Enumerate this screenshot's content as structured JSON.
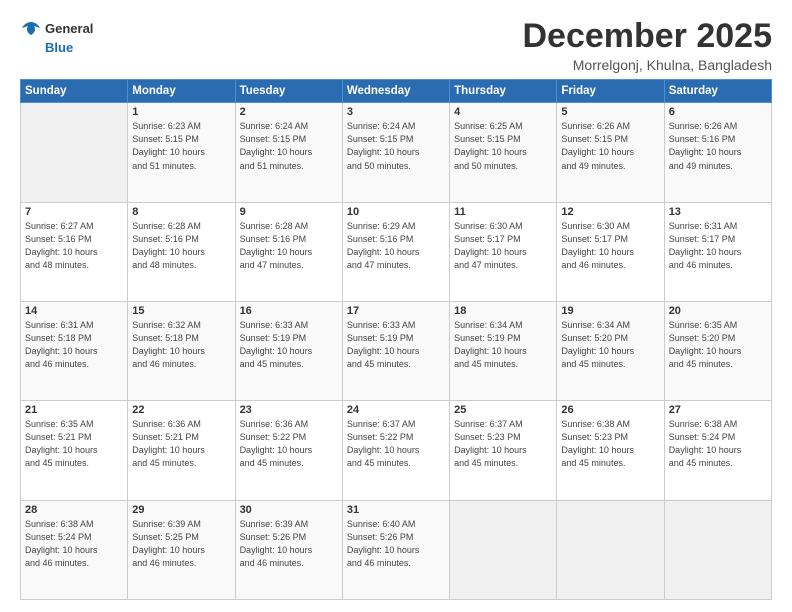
{
  "header": {
    "logo_line1": "General",
    "logo_line2": "Blue",
    "month_title": "December 2025",
    "subtitle": "Morrelgonj, Khulna, Bangladesh"
  },
  "weekdays": [
    "Sunday",
    "Monday",
    "Tuesday",
    "Wednesday",
    "Thursday",
    "Friday",
    "Saturday"
  ],
  "weeks": [
    [
      {
        "day": "",
        "info": ""
      },
      {
        "day": "1",
        "info": "Sunrise: 6:23 AM\nSunset: 5:15 PM\nDaylight: 10 hours\nand 51 minutes."
      },
      {
        "day": "2",
        "info": "Sunrise: 6:24 AM\nSunset: 5:15 PM\nDaylight: 10 hours\nand 51 minutes."
      },
      {
        "day": "3",
        "info": "Sunrise: 6:24 AM\nSunset: 5:15 PM\nDaylight: 10 hours\nand 50 minutes."
      },
      {
        "day": "4",
        "info": "Sunrise: 6:25 AM\nSunset: 5:15 PM\nDaylight: 10 hours\nand 50 minutes."
      },
      {
        "day": "5",
        "info": "Sunrise: 6:26 AM\nSunset: 5:15 PM\nDaylight: 10 hours\nand 49 minutes."
      },
      {
        "day": "6",
        "info": "Sunrise: 6:26 AM\nSunset: 5:16 PM\nDaylight: 10 hours\nand 49 minutes."
      }
    ],
    [
      {
        "day": "7",
        "info": "Sunrise: 6:27 AM\nSunset: 5:16 PM\nDaylight: 10 hours\nand 48 minutes."
      },
      {
        "day": "8",
        "info": "Sunrise: 6:28 AM\nSunset: 5:16 PM\nDaylight: 10 hours\nand 48 minutes."
      },
      {
        "day": "9",
        "info": "Sunrise: 6:28 AM\nSunset: 5:16 PM\nDaylight: 10 hours\nand 47 minutes."
      },
      {
        "day": "10",
        "info": "Sunrise: 6:29 AM\nSunset: 5:16 PM\nDaylight: 10 hours\nand 47 minutes."
      },
      {
        "day": "11",
        "info": "Sunrise: 6:30 AM\nSunset: 5:17 PM\nDaylight: 10 hours\nand 47 minutes."
      },
      {
        "day": "12",
        "info": "Sunrise: 6:30 AM\nSunset: 5:17 PM\nDaylight: 10 hours\nand 46 minutes."
      },
      {
        "day": "13",
        "info": "Sunrise: 6:31 AM\nSunset: 5:17 PM\nDaylight: 10 hours\nand 46 minutes."
      }
    ],
    [
      {
        "day": "14",
        "info": "Sunrise: 6:31 AM\nSunset: 5:18 PM\nDaylight: 10 hours\nand 46 minutes."
      },
      {
        "day": "15",
        "info": "Sunrise: 6:32 AM\nSunset: 5:18 PM\nDaylight: 10 hours\nand 46 minutes."
      },
      {
        "day": "16",
        "info": "Sunrise: 6:33 AM\nSunset: 5:19 PM\nDaylight: 10 hours\nand 45 minutes."
      },
      {
        "day": "17",
        "info": "Sunrise: 6:33 AM\nSunset: 5:19 PM\nDaylight: 10 hours\nand 45 minutes."
      },
      {
        "day": "18",
        "info": "Sunrise: 6:34 AM\nSunset: 5:19 PM\nDaylight: 10 hours\nand 45 minutes."
      },
      {
        "day": "19",
        "info": "Sunrise: 6:34 AM\nSunset: 5:20 PM\nDaylight: 10 hours\nand 45 minutes."
      },
      {
        "day": "20",
        "info": "Sunrise: 6:35 AM\nSunset: 5:20 PM\nDaylight: 10 hours\nand 45 minutes."
      }
    ],
    [
      {
        "day": "21",
        "info": "Sunrise: 6:35 AM\nSunset: 5:21 PM\nDaylight: 10 hours\nand 45 minutes."
      },
      {
        "day": "22",
        "info": "Sunrise: 6:36 AM\nSunset: 5:21 PM\nDaylight: 10 hours\nand 45 minutes."
      },
      {
        "day": "23",
        "info": "Sunrise: 6:36 AM\nSunset: 5:22 PM\nDaylight: 10 hours\nand 45 minutes."
      },
      {
        "day": "24",
        "info": "Sunrise: 6:37 AM\nSunset: 5:22 PM\nDaylight: 10 hours\nand 45 minutes."
      },
      {
        "day": "25",
        "info": "Sunrise: 6:37 AM\nSunset: 5:23 PM\nDaylight: 10 hours\nand 45 minutes."
      },
      {
        "day": "26",
        "info": "Sunrise: 6:38 AM\nSunset: 5:23 PM\nDaylight: 10 hours\nand 45 minutes."
      },
      {
        "day": "27",
        "info": "Sunrise: 6:38 AM\nSunset: 5:24 PM\nDaylight: 10 hours\nand 45 minutes."
      }
    ],
    [
      {
        "day": "28",
        "info": "Sunrise: 6:38 AM\nSunset: 5:24 PM\nDaylight: 10 hours\nand 46 minutes."
      },
      {
        "day": "29",
        "info": "Sunrise: 6:39 AM\nSunset: 5:25 PM\nDaylight: 10 hours\nand 46 minutes."
      },
      {
        "day": "30",
        "info": "Sunrise: 6:39 AM\nSunset: 5:26 PM\nDaylight: 10 hours\nand 46 minutes."
      },
      {
        "day": "31",
        "info": "Sunrise: 6:40 AM\nSunset: 5:26 PM\nDaylight: 10 hours\nand 46 minutes."
      },
      {
        "day": "",
        "info": ""
      },
      {
        "day": "",
        "info": ""
      },
      {
        "day": "",
        "info": ""
      }
    ]
  ]
}
